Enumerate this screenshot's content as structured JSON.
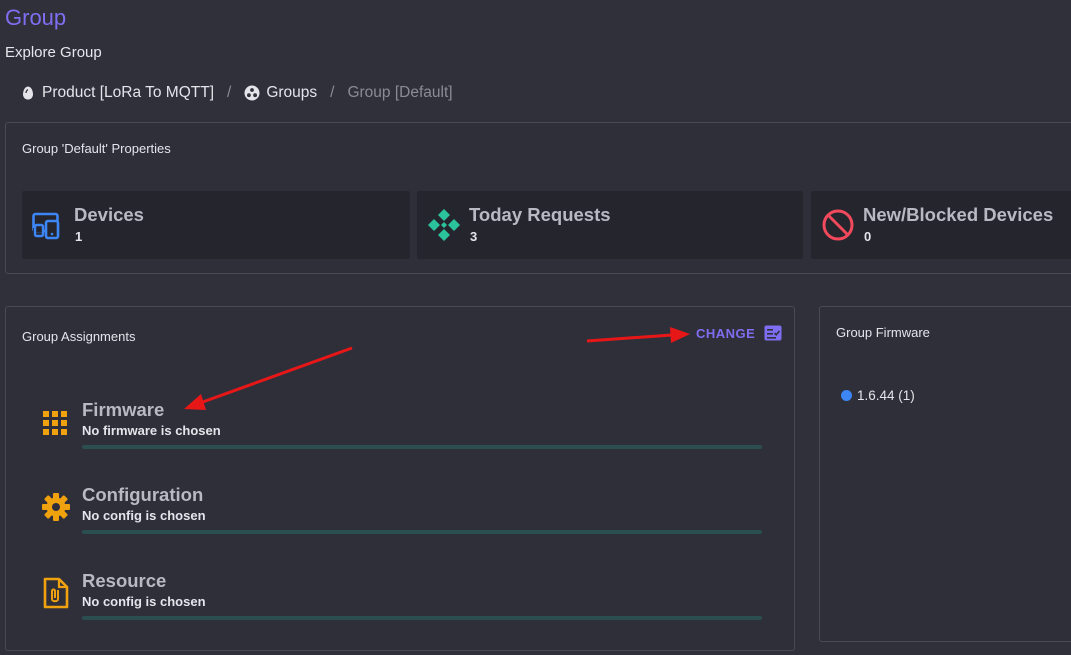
{
  "page": {
    "title": "Group",
    "subtitle": "Explore Group"
  },
  "breadcrumb": [
    {
      "label": "Product [LoRa To MQTT]",
      "icon": "egg-icon"
    },
    {
      "label": "Groups",
      "icon": "group-icon"
    },
    {
      "label": "Group [Default]"
    }
  ],
  "breadcrumb_separator": "/",
  "properties": {
    "title": "Group 'Default' Properties",
    "stats": [
      {
        "label": "Devices",
        "value": "1",
        "icon": "devices-icon",
        "color": "#3d86f5"
      },
      {
        "label": "Today Requests",
        "value": "3",
        "icon": "requests-icon",
        "color": "#2bc39b"
      },
      {
        "label": "New/Blocked Devices",
        "value": "0",
        "icon": "blocked-icon",
        "color": "#f2495c"
      }
    ]
  },
  "assignments": {
    "title": "Group Assignments",
    "change_label": "CHANGE",
    "items": [
      {
        "label": "Firmware",
        "value": "No firmware is chosen",
        "icon": "firmware-icon"
      },
      {
        "label": "Configuration",
        "value": "No config is chosen",
        "icon": "gear-icon"
      },
      {
        "label": "Resource",
        "value": "No config is chosen",
        "icon": "file-attachment-icon"
      }
    ]
  },
  "group_firmware": {
    "title": "Group Firmware",
    "items": [
      {
        "label": "1.6.44 (1)",
        "color": "#3d86f5"
      }
    ]
  },
  "colors": {
    "accent": "#7e6ff2",
    "icon_orange": "#f0a20e",
    "annotation_arrow": "#e81717",
    "background": "#30303b"
  }
}
